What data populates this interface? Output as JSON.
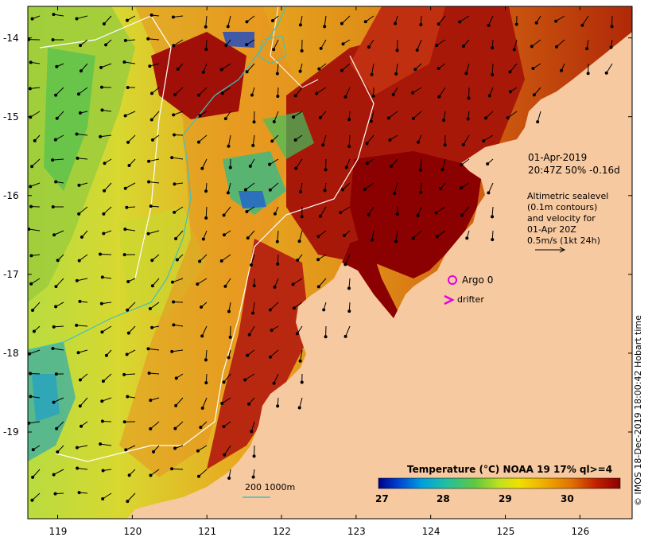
{
  "map": {
    "lon_ticks": [
      "119",
      "120",
      "121",
      "122",
      "123",
      "124",
      "125",
      "126"
    ],
    "lat_ticks": [
      "-14",
      "-15",
      "-16",
      "-17",
      "-18",
      "-19"
    ],
    "lon_range": [
      118.6,
      126.7
    ],
    "lat_range": [
      -20.1,
      -13.6
    ]
  },
  "annotation": {
    "date": "01-Apr-2019",
    "time_line": "20:47Z  50% -0.16d",
    "altimetry_lines": [
      "Altimetric sealevel",
      "(0.1m contours)",
      "and velocity for",
      "01-Apr 20Z",
      "0.5m/s (1kt 24h)"
    ]
  },
  "markers": {
    "argo_label": "Argo 0",
    "drifter_label": "drifter",
    "argo_color": "#e000e0",
    "drifter_color": "#e000e0"
  },
  "colorbar": {
    "title": "Temperature (°C) NOAA 19 17% ql>=4",
    "ticks": [
      "27",
      "28",
      "29",
      "30"
    ],
    "range": [
      27,
      30.9
    ],
    "colors": [
      "#00008b",
      "#0030c0",
      "#0070e0",
      "#00b0e0",
      "#20c0a0",
      "#40c060",
      "#80d040",
      "#c0e020",
      "#f0e000",
      "#f0b000",
      "#e08000",
      "#d05000",
      "#b01000",
      "#8b0000"
    ]
  },
  "depth_legend": {
    "label": "200  1000m"
  },
  "credit": "© IMOS 18-Dec-2019 18:00:42 Hobart time",
  "colors": {
    "land": "#f7c9a0",
    "contour": "#ffffff",
    "isobath": "#40c0c0"
  }
}
